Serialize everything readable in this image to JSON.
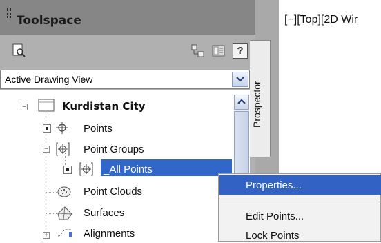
{
  "toolspace": {
    "title": "Toolspace",
    "toolbar": {
      "help_label": "?"
    },
    "view_dropdown": {
      "selected": "Active Drawing View"
    },
    "tree": {
      "root": "Kurdistan City",
      "items": [
        {
          "label": "Points"
        },
        {
          "label": "Point Groups"
        },
        {
          "label": "_All Points",
          "selected": true
        },
        {
          "label": "Point Clouds"
        },
        {
          "label": "Surfaces"
        },
        {
          "label": "Alignments"
        }
      ]
    },
    "side_tab": "Prospector"
  },
  "viewport": {
    "label": "[−][Top][2D Wir"
  },
  "context_menu": {
    "items": [
      {
        "label": "Properties...",
        "highlighted": true
      },
      {
        "label": "Edit Points..."
      },
      {
        "label": "Lock Points"
      }
    ]
  },
  "colors": {
    "selection": "#3067c9",
    "menu_highlight": "#3262c4",
    "panel_bg": "#a9a9a9",
    "title_bg": "#868686"
  }
}
